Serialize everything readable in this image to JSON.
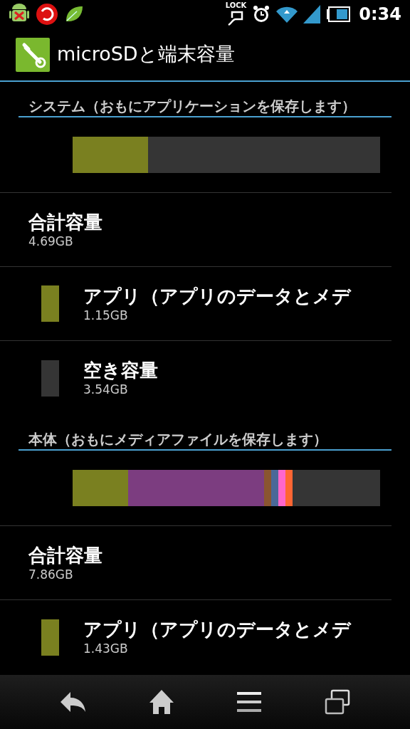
{
  "status_bar": {
    "time": "0:34",
    "lock_label": "LOCK"
  },
  "title": "microSDと端末容量",
  "sections": [
    {
      "header": "システム（おもにアプリケーションを保存します）",
      "segments": [
        {
          "color": "#7a8020",
          "level": 0.245
        }
      ],
      "total_label": "合計容量",
      "total_value": "4.69GB",
      "items": [
        {
          "color": "#7a8020",
          "label": "アプリ（アプリのデータとメデ",
          "value": "1.15GB"
        },
        {
          "color": "#353535",
          "label": "空き容量",
          "value": "3.54GB"
        }
      ]
    },
    {
      "header": "本体（おもにメディアファイルを保存します）",
      "segments": [
        {
          "color": "#7a8020",
          "level": 0.18
        },
        {
          "color": "#7c3d80",
          "level": 0.442
        },
        {
          "color": "#8a5530"
        },
        {
          "color": "#4a6898"
        },
        {
          "color": "#ff66cc"
        },
        {
          "color": "#ff6633"
        }
      ],
      "total_label": "合計容量",
      "total_value": "7.86GB",
      "items": [
        {
          "color": "#7a8020",
          "label": "アプリ（アプリのデータとメデ",
          "value": "1.43GB"
        }
      ]
    }
  ]
}
